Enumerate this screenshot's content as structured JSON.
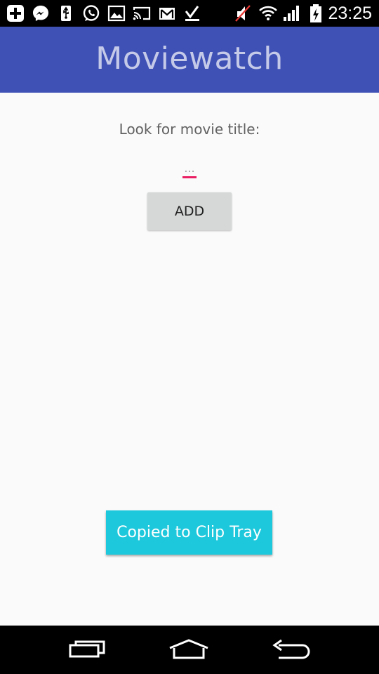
{
  "status_bar": {
    "time": "23:25",
    "icons": [
      "add-box-icon",
      "messenger-icon",
      "usb-icon",
      "whatsapp-icon",
      "image-icon",
      "cast-icon",
      "gmail-icon",
      "download-done-icon",
      "sound-muted-icon",
      "wifi-icon",
      "signal-icon",
      "battery-charging-icon"
    ]
  },
  "app_bar": {
    "title": "Moviewatch"
  },
  "main": {
    "prompt_label": "Look for movie title:",
    "input_placeholder": "...",
    "input_value": "",
    "add_button_label": "ADD"
  },
  "toast": {
    "message": "Copied to Clip Tray"
  },
  "nav_bar": {
    "icons": [
      "recent-apps-icon",
      "home-icon",
      "back-icon"
    ]
  },
  "colors": {
    "app_bar": "#3f51b5",
    "title_text": "#c5cae9",
    "accent": "#e91e63",
    "toast_bg": "#1ec8dc",
    "button_bg": "#d6d7d7"
  }
}
